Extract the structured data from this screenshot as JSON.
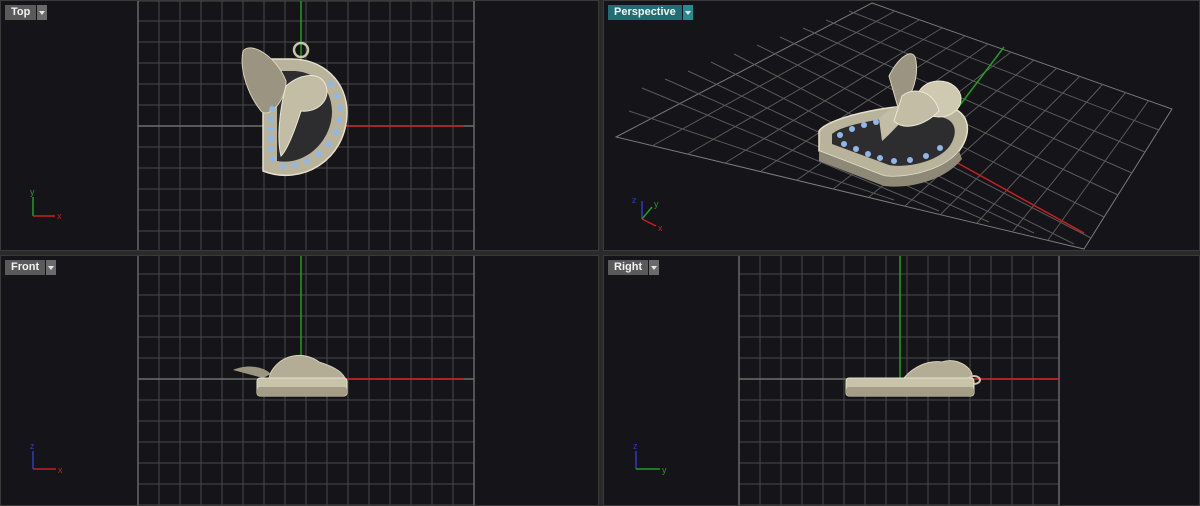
{
  "viewports": [
    {
      "id": "top",
      "title": "Top",
      "active": false,
      "axes": [
        "y",
        "x"
      ]
    },
    {
      "id": "perspective",
      "title": "Perspective",
      "active": true,
      "axes": [
        "z",
        "y",
        "x"
      ]
    },
    {
      "id": "front",
      "title": "Front",
      "active": false,
      "axes": [
        "z",
        "x"
      ]
    },
    {
      "id": "right",
      "title": "Right",
      "active": false,
      "axes": [
        "z",
        "y"
      ]
    }
  ],
  "colors": {
    "background": "#141419",
    "grid": "#4a4a4a",
    "x_axis": "#c81e1e",
    "y_axis": "#1ea01e",
    "z_axis": "#2d3cc8",
    "model_metal": "#c9c3aa",
    "gem": "#8fb8e8",
    "active_title": "#1f6e74"
  },
  "icons": [
    "chevron-down-icon",
    "axis-widget-icon"
  ]
}
